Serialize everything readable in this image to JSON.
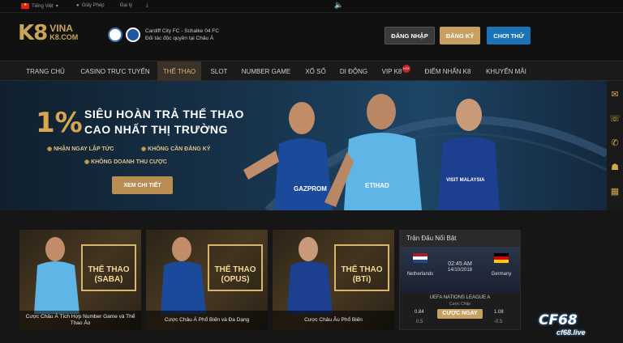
{
  "topbar": {
    "language": "Tiếng Việt",
    "license": "Giấy Phép",
    "agent": "Đại lý"
  },
  "header": {
    "logo_main": "K8",
    "logo_top": "VINA",
    "logo_bottom": "K8.COM",
    "partner_line1": "Cardiff City FC - Schalke 04 FC",
    "partner_line2": "Đối tác độc quyền tại Châu Á",
    "login": "ĐĂNG NHẬP",
    "register": "ĐĂNG KÝ",
    "try": "CHƠI THỬ"
  },
  "nav": {
    "items": [
      "TRANG CHỦ",
      "CASINO TRỰC TUYẾN",
      "THỂ THAO",
      "SLOT",
      "NUMBER GAME",
      "XỔ SỐ",
      "DI ĐỘNG",
      "VIP K8",
      "ĐIỂM NHẤN K8",
      "KHUYẾN MÃI"
    ],
    "hot": "HOT"
  },
  "banner": {
    "percent": "1%",
    "title_line1": "SIÊU HOÀN TRẢ THỂ THAO",
    "title_line2": "CAO NHẤT THỊ TRƯỜNG",
    "bullet1": "NHẬN NGAY LẬP TỨC",
    "bullet2": "KHÔNG CẦN ĐĂNG KÝ",
    "bullet3": "KHÔNG DOANH THU CƯỢC",
    "detail": "XEM CHI TIẾT",
    "jersey1": "GAZPROM",
    "jersey2": "ETIHAD",
    "jersey3": "VISIT MALAYSIA"
  },
  "cards": [
    {
      "title1": "THỂ THAO",
      "title2": "(SABA)",
      "caption": "Cược Châu Á Tích Hợp Number Game và Thể Thao Ảo"
    },
    {
      "title1": "THỂ THAO",
      "title2": "(OPUS)",
      "caption": "Cược Châu Á Phổ Biến và Đa Dạng"
    },
    {
      "title1": "THỂ THAO",
      "title2": "(BTi)",
      "caption": "Cược Châu Âu Phổ Biến"
    }
  ],
  "match": {
    "header": "Trận Đấu Nổi Bật",
    "time": "02:45 AM",
    "date": "14/10/2018",
    "home": "Netherlands",
    "away": "Germany",
    "league": "UEFA NATIONS LEAGUE A",
    "market": "Cược Chấp",
    "home_odds": "0.84",
    "home_hdp": "0.5",
    "away_odds": "1.08",
    "away_hdp": "-0.5",
    "bet": "CƯỢC NGAY"
  },
  "watermark": {
    "big": "CF68",
    "small": "cf68.live"
  }
}
